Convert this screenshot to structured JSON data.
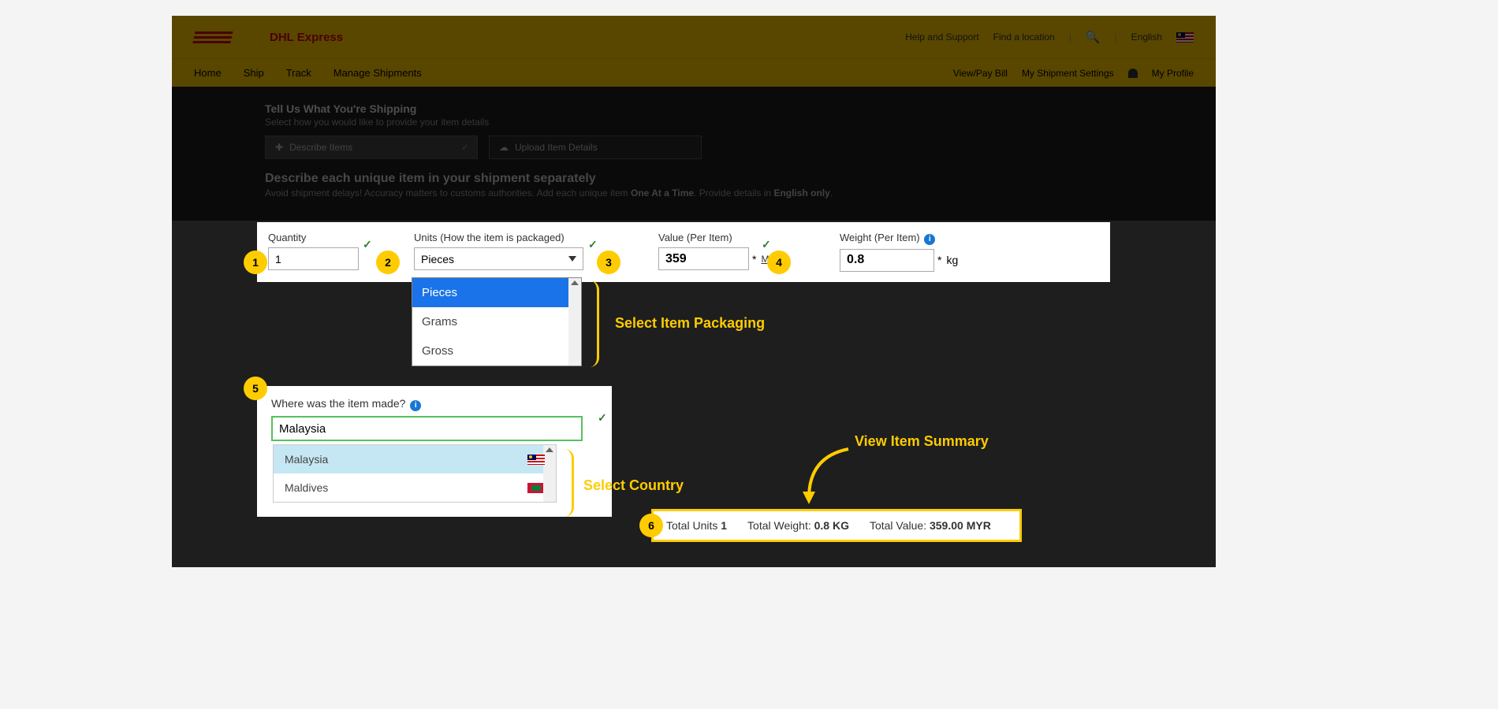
{
  "header": {
    "brand": "DHL Express",
    "help": "Help and Support",
    "find_location": "Find a location",
    "language": "English"
  },
  "nav": {
    "home": "Home",
    "ship": "Ship",
    "track": "Track",
    "manage": "Manage Shipments",
    "view_pay": "View/Pay Bill",
    "settings": "My Shipment Settings",
    "profile": "My Profile"
  },
  "section": {
    "title": "Tell Us What You're Shipping",
    "subtitle": "Select how you would like to provide your item details",
    "tab_describe": "Describe Items",
    "tab_upload": "Upload Item Details",
    "desc_heading": "Describe each unique item in your shipment separately",
    "desc_sub_pre": "Avoid shipment delays! Accuracy matters to customs authorities.  Add each unique item ",
    "desc_sub_b1": "One At a Time",
    "desc_sub_mid": ".  Provide details in ",
    "desc_sub_b2": "English only",
    "desc_sub_end": "."
  },
  "fields": {
    "quantity_label": "Quantity",
    "quantity_value": "1",
    "units_label": "Units (How the item is packaged)",
    "units_value": "Pieces",
    "units_options": {
      "o1": "Pieces",
      "o2": "Grams",
      "o3": "Gross"
    },
    "value_label": "Value (Per Item)",
    "value_value": "359",
    "currency": "MYR",
    "weight_label": "Weight (Per Item)",
    "weight_value": "0.8",
    "weight_unit": "kg"
  },
  "country": {
    "label": "Where was the item made?",
    "value": "Malaysia",
    "opt1": "Malaysia",
    "opt2": "Maldives"
  },
  "annotations": {
    "select_packaging": "Select Item Packaging",
    "select_country": "Select Country",
    "view_summary": "View Item Summary"
  },
  "summary": {
    "units_label": "Total Units",
    "units_value": "1",
    "weight_label": "Total Weight:",
    "weight_value": "0.8 KG",
    "value_label": "Total Value:",
    "value_value": "359.00 MYR"
  },
  "badges": {
    "b1": "1",
    "b2": "2",
    "b3": "3",
    "b4": "4",
    "b5": "5",
    "b6": "6"
  }
}
